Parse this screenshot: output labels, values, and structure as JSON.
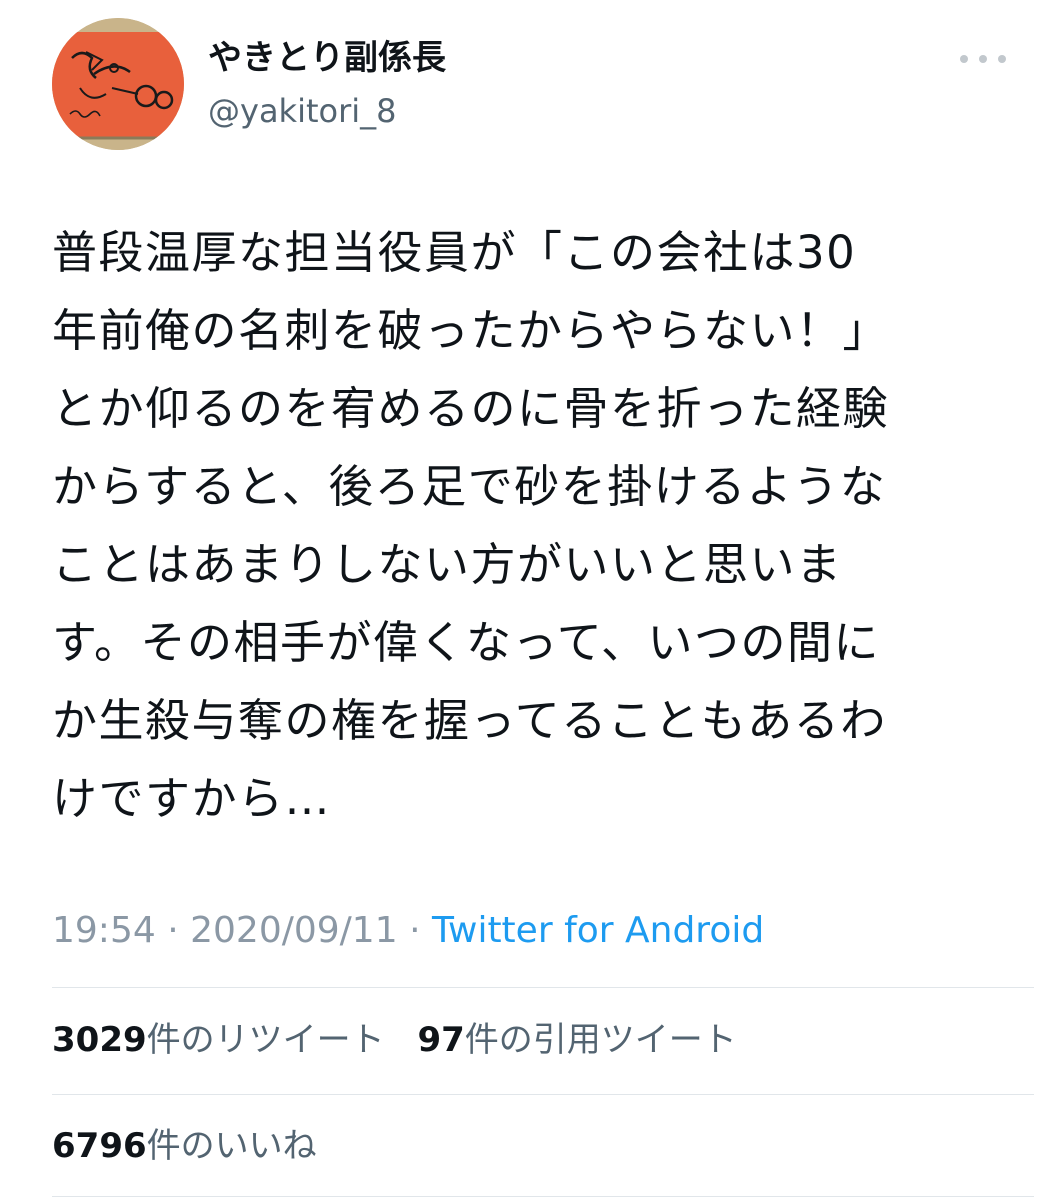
{
  "user": {
    "display_name": "やきとり副係長",
    "handle": "@yakitori_8",
    "avatar_icon": "avatar-doodle-icon"
  },
  "tweet": {
    "lines": [
      "普段温厚な担当役員が「この会社は30",
      "年前俺の名刺を破ったからやらない！」",
      "とか仰るのを宥めるのに骨を折った経験",
      "からすると、後ろ足で砂を掛けるような",
      "ことはあまりしない方がいいと思いま",
      "す。その相手が偉くなって、いつの間に",
      "か生殺与奪の権を握ってることもあるわ",
      "けですから…"
    ]
  },
  "meta": {
    "time": "19:54",
    "separator": "·",
    "date": "2020/09/11",
    "source": "Twitter for Android"
  },
  "stats": {
    "retweets_count": "3029",
    "retweets_label": "件のリツイート",
    "quotes_count": "97",
    "quotes_label": "件の引用ツイート",
    "likes_count": "6796",
    "likes_label": "件のいいね"
  },
  "colors": {
    "link": "#1d9bf0",
    "muted": "#8b98a5",
    "text": "#0f1419",
    "avatar_bg": "#e8603c"
  }
}
